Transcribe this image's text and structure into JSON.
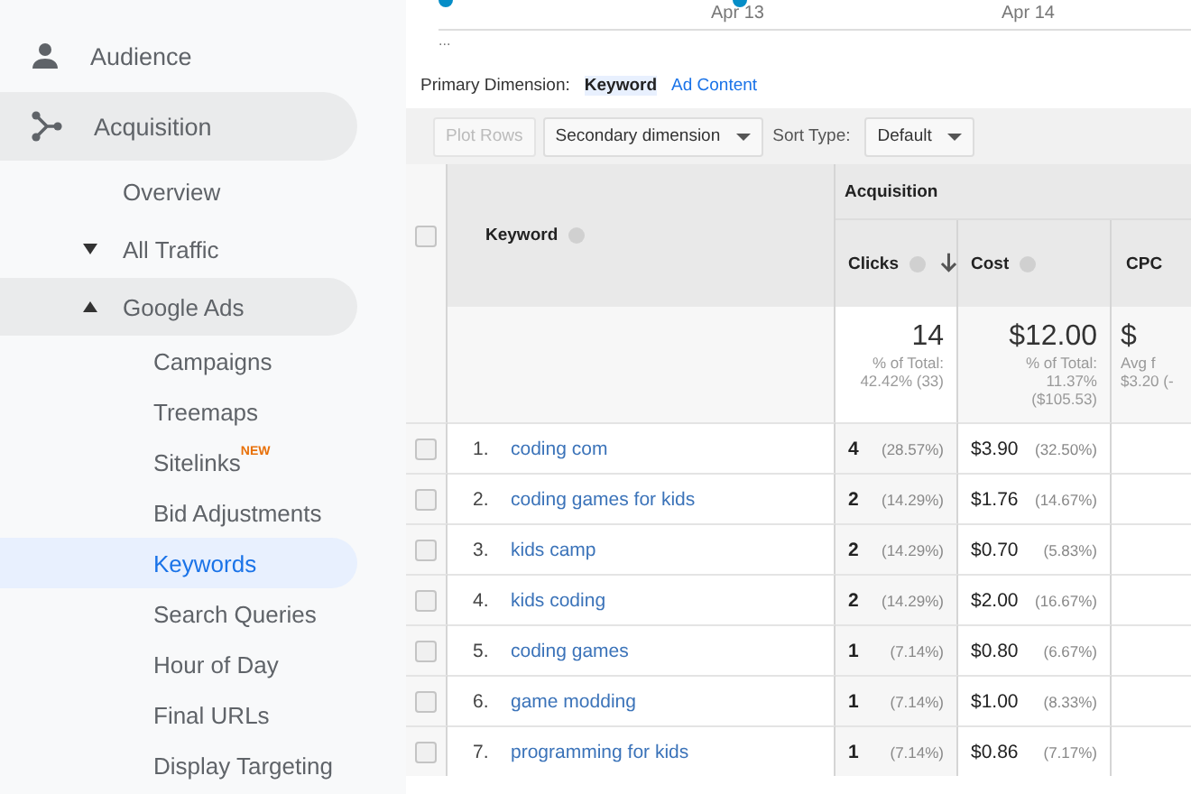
{
  "sidebar": {
    "items": [
      {
        "label": "Audience",
        "kind": "section",
        "expanded": false
      },
      {
        "label": "Acquisition",
        "kind": "section",
        "expanded": true,
        "children": [
          {
            "label": "Overview",
            "kind": "link",
            "selected": false
          },
          {
            "label": "All Traffic",
            "kind": "group",
            "expanded": false
          },
          {
            "label": "Google Ads",
            "kind": "group",
            "expanded": true,
            "children": [
              {
                "label": "Campaigns",
                "kind": "link",
                "selected": false
              },
              {
                "label": "Treemaps",
                "kind": "link",
                "selected": false
              },
              {
                "label": "Sitelinks",
                "badge": "NEW",
                "kind": "link",
                "selected": false
              },
              {
                "label": "Bid Adjustments",
                "kind": "link",
                "selected": false
              },
              {
                "label": "Keywords",
                "kind": "link",
                "selected": true
              },
              {
                "label": "Search Queries",
                "kind": "link",
                "selected": false
              },
              {
                "label": "Hour of Day",
                "kind": "link",
                "selected": false
              },
              {
                "label": "Final URLs",
                "kind": "link",
                "selected": false
              },
              {
                "label": "Display Targeting",
                "kind": "link",
                "selected": false
              }
            ]
          }
        ]
      }
    ]
  },
  "chart_strip": {
    "labels": [
      "...",
      "Apr 13",
      "Apr 14"
    ]
  },
  "primary_dimension": {
    "label": "Primary Dimension:",
    "options": [
      {
        "label": "Keyword",
        "selected": true
      },
      {
        "label": "Ad Content",
        "selected": false
      }
    ]
  },
  "toolbar": {
    "plot_rows": {
      "label": "Plot Rows",
      "disabled": true
    },
    "secondary_dimension": "Secondary dimension",
    "sort_type_label": "Sort Type:",
    "sort_type": "Default"
  },
  "table": {
    "select_all_checked": false,
    "keyword_header": "Keyword",
    "group_header": "Acquisition",
    "columns": [
      {
        "label": "Clicks",
        "help": true,
        "sorted": true,
        "total": "14",
        "total_note": [
          "% of Total:",
          "42.42% (33)"
        ]
      },
      {
        "label": "Cost",
        "help": true,
        "total": "$12.00",
        "total_note": [
          "% of Total:",
          "11.37%",
          "($105.53)"
        ]
      },
      {
        "label": "CPC",
        "total": "$",
        "total_note": [
          "Avg f",
          "$3.20 (-"
        ]
      }
    ],
    "rows": [
      {
        "number": "1.",
        "keyword": "coding com",
        "checked": false,
        "clicks": "4",
        "clicks_pct": "(28.57%)",
        "cost": "$3.90",
        "cost_pct": "(32.50%)"
      },
      {
        "number": "2.",
        "keyword": "coding games for kids",
        "checked": false,
        "clicks": "2",
        "clicks_pct": "(14.29%)",
        "cost": "$1.76",
        "cost_pct": "(14.67%)"
      },
      {
        "number": "3.",
        "keyword": "kids camp",
        "checked": false,
        "clicks": "2",
        "clicks_pct": "(14.29%)",
        "cost": "$0.70",
        "cost_pct": "(5.83%)"
      },
      {
        "number": "4.",
        "keyword": "kids coding",
        "checked": false,
        "clicks": "2",
        "clicks_pct": "(14.29%)",
        "cost": "$2.00",
        "cost_pct": "(16.67%)"
      },
      {
        "number": "5.",
        "keyword": "coding games",
        "checked": false,
        "clicks": "1",
        "clicks_pct": "(7.14%)",
        "cost": "$0.80",
        "cost_pct": "(6.67%)"
      },
      {
        "number": "6.",
        "keyword": "game modding",
        "checked": false,
        "clicks": "1",
        "clicks_pct": "(7.14%)",
        "cost": "$1.00",
        "cost_pct": "(8.33%)"
      },
      {
        "number": "7.",
        "keyword": "programming for kids",
        "checked": false,
        "clicks": "1",
        "clicks_pct": "(7.14%)",
        "cost": "$0.86",
        "cost_pct": "(7.17%)"
      }
    ]
  }
}
